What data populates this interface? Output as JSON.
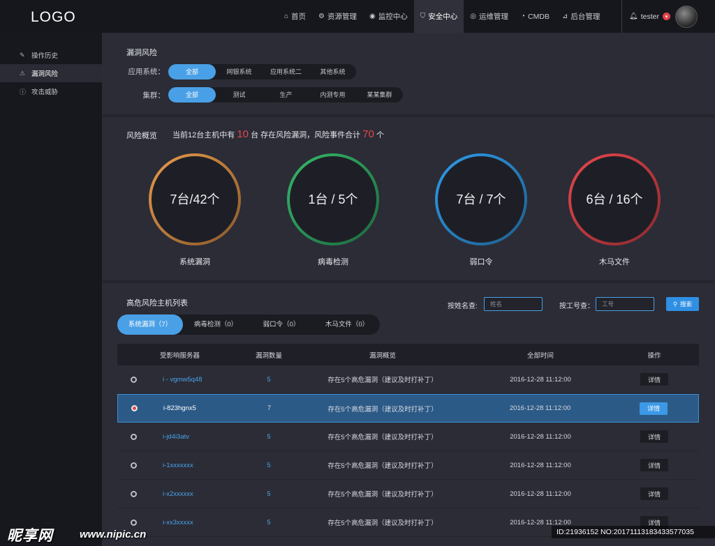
{
  "header": {
    "logo": "LOGO",
    "nav": [
      {
        "icon": "home-icon",
        "glyph": "⌂",
        "label": "首页",
        "active": false
      },
      {
        "icon": "gear-icon",
        "glyph": "⚙",
        "label": "资源管理",
        "active": false
      },
      {
        "icon": "eye-icon",
        "glyph": "◉",
        "label": "监控中心",
        "active": false
      },
      {
        "icon": "shield-icon",
        "glyph": "⛉",
        "label": "安全中心",
        "active": true
      },
      {
        "icon": "ops-icon",
        "glyph": "◎",
        "label": "运维管理",
        "active": false
      },
      {
        "icon": "pie-icon",
        "glyph": "◔",
        "label": "CMDB",
        "active": false
      },
      {
        "icon": "chart-icon",
        "glyph": "⊿",
        "label": "后台管理",
        "active": false
      }
    ],
    "user": {
      "name": "tester"
    }
  },
  "sidebar": {
    "items": [
      {
        "icon": "edit-icon",
        "glyph": "✎",
        "label": "操作历史",
        "active": false
      },
      {
        "icon": "warning-icon",
        "glyph": "⚠",
        "label": "漏洞风险",
        "active": true
      },
      {
        "icon": "alert-icon",
        "glyph": "ⓘ",
        "label": "攻击威胁",
        "active": false
      }
    ]
  },
  "filters": {
    "title": "漏洞风险",
    "app_label": "应用系统：",
    "app_options": [
      {
        "label": "全部",
        "on": true
      },
      {
        "label": "网银系统",
        "on": false
      },
      {
        "label": "应用系统二",
        "on": false
      },
      {
        "label": "其他系统",
        "on": false
      }
    ],
    "cluster_label": "集群：",
    "cluster_options": [
      {
        "label": "全部",
        "on": true
      },
      {
        "label": "测试",
        "on": false
      },
      {
        "label": "生产",
        "on": false
      },
      {
        "label": "内测专用",
        "on": false
      },
      {
        "label": "某某集群",
        "on": false
      }
    ]
  },
  "overview": {
    "title": "风险概览",
    "text_prefix": "当前12台主机中有",
    "hosts_at_risk": "10",
    "text_middle": "台 存在风险漏洞，风险事件合计",
    "event_total": "70",
    "text_suffix": "个",
    "cards": [
      {
        "value": "7台/42个",
        "label": "系统漏洞",
        "color": "#e79a4a",
        "dark": "#8a5a2c"
      },
      {
        "value": "1台 / 5个",
        "label": "病毒检测",
        "color": "#35b86a",
        "dark": "#1d6a3e"
      },
      {
        "value": "7台 / 7个",
        "label": "弱口令",
        "color": "#2f9bea",
        "dark": "#1f5f8e"
      },
      {
        "value": "6台 / 16个",
        "label": "木马文件",
        "color": "#e8474d",
        "dark": "#8c2a2e"
      }
    ]
  },
  "hostlist": {
    "title": "高危风险主机列表",
    "name_label": "按姓名查:",
    "name_placeholder": "姓名",
    "id_label": "按工号查：",
    "id_placeholder": "工号",
    "search_label": "搜索",
    "tabs": [
      {
        "label": "系统漏洞（7）",
        "on": true
      },
      {
        "label": "病毒检测（0）",
        "on": false
      },
      {
        "label": "弱口令（0）",
        "on": false
      },
      {
        "label": "木马文件（0）",
        "on": false
      }
    ],
    "columns": [
      "受影响服务器",
      "漏洞数量",
      "漏洞概览",
      "全部时间",
      "操作"
    ],
    "rows": [
      {
        "server": "i - vgmw5q48",
        "count": "5",
        "summary": "存在5个高危漏洞（建议及时打补丁）",
        "time": "2016-12-28 11:12:00",
        "action": "详情",
        "selected": false
      },
      {
        "server": "i-823hgnx5",
        "count": "7",
        "summary": "存在5个高危漏洞（建议及时打补丁）",
        "time": "2016-12-28 11:12:00",
        "action": "详情",
        "selected": true
      },
      {
        "server": "i-jd4i3atv",
        "count": "5",
        "summary": "存在5个高危漏洞（建议及时打补丁）",
        "time": "2016-12-28 11:12:00",
        "action": "详情",
        "selected": false
      },
      {
        "server": "i-1xxxxxxx",
        "count": "5",
        "summary": "存在5个高危漏洞（建议及时打补丁）",
        "time": "2016-12-28 11:12:00",
        "action": "详情",
        "selected": false
      },
      {
        "server": "i-x2xxxxxx",
        "count": "5",
        "summary": "存在5个高危漏洞（建议及时打补丁）",
        "time": "2016-12-28 11:12:00",
        "action": "详情",
        "selected": false
      },
      {
        "server": "i-xx3xxxxx",
        "count": "5",
        "summary": "存在5个高危漏洞（建议及时打补丁）",
        "time": "2016-12-28 11:12:00",
        "action": "详情",
        "selected": false
      }
    ]
  },
  "watermark": {
    "brand": "昵享网",
    "site": "www.nipic.cn",
    "stamp": "ID:21936152 NO:20171113183433577035"
  }
}
